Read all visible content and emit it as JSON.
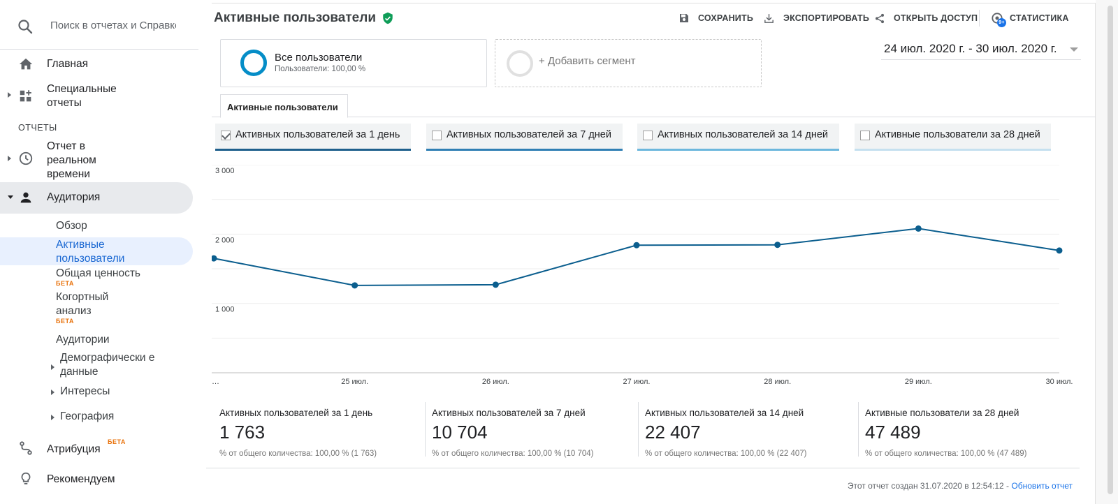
{
  "search": {
    "placeholder": "Поиск в отчетах и Справке"
  },
  "sidebar": {
    "home": "Главная",
    "custom_reports": "Специальные отчеты",
    "section_reports": "ОТЧЕТЫ",
    "realtime": "Отчет в реальном времени",
    "audience": "Аудитория",
    "sub_items": {
      "overview": "Обзор",
      "active_users": "Активные пользователи",
      "lifetime_value": "Общая ценность",
      "cohort": "Когортный анализ",
      "audiences": "Аудитории",
      "demographics": "Демографически е данные",
      "interests": "Интересы",
      "geo": "География"
    },
    "beta": "БЕТА",
    "attribution": "Атрибуция",
    "discover": "Рекомендуем"
  },
  "header": {
    "title": "Активные пользователи",
    "save": "СОХРАНИТЬ",
    "export": "ЭКСПОРТИРОВАТЬ",
    "share": "ОТКРЫТЬ ДОСТУП",
    "insights": "СТАТИСТИКА",
    "insights_badge": "9+"
  },
  "segments": {
    "all_title": "Все пользователи",
    "all_sub": "Пользователи: 100,00 %",
    "add": "+ Добавить сегмент"
  },
  "date_range": "24 июл. 2020 г. - 30 июл. 2020 г.",
  "tab": "Активные пользователи",
  "metric_tabs": [
    {
      "label": "Активных пользователей за 1 день",
      "checked": true,
      "color": "#1e5f8c"
    },
    {
      "label": "Активных пользователей за 7 дней",
      "checked": false,
      "color": "#2f7fb4"
    },
    {
      "label": "Активных пользователей за 14 дней",
      "checked": false,
      "color": "#6cb7dd"
    },
    {
      "label": "Активные пользователи за 28 дней",
      "checked": false,
      "color": "#c5e0ef"
    }
  ],
  "chart_data": {
    "type": "line",
    "x": [
      "…",
      "25 июл.",
      "26 июл.",
      "27 июл.",
      "28 июл.",
      "29 июл.",
      "30 июл."
    ],
    "series": [
      {
        "values": [
          1650,
          1260,
          1270,
          1840,
          1845,
          2080,
          1763
        ]
      }
    ],
    "yticks": [
      "3 000",
      "2 000",
      "1 000"
    ],
    "ylim": [
      0,
      3000
    ],
    "grid": true,
    "color": "#0b5e8e"
  },
  "stats": [
    {
      "title": "Активных пользователей за 1 день",
      "value": "1 763",
      "sub": "% от общего количества: 100,00 % (1 763)"
    },
    {
      "title": "Активных пользователей за 7 дней",
      "value": "10 704",
      "sub": "% от общего количества: 100,00 % (10 704)"
    },
    {
      "title": "Активных пользователей за 14 дней",
      "value": "22 407",
      "sub": "% от общего количества: 100,00 % (22 407)"
    },
    {
      "title": "Активные пользователи за 28 дней",
      "value": "47 489",
      "sub": "% от общего количества: 100,00 % (47 489)"
    }
  ],
  "footer": {
    "text": "Этот отчет создан 31.07.2020 в 12:54:12 - ",
    "link": "Обновить отчет"
  }
}
